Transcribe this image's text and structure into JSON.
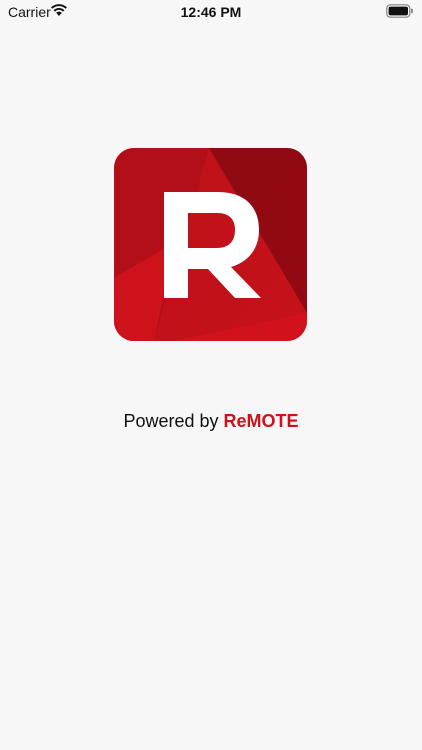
{
  "status_bar": {
    "carrier": "Carrier",
    "time": "12:46 PM",
    "icons": [
      "wifi-icon",
      "battery-icon"
    ]
  },
  "logo": {
    "letter": "R",
    "colors": {
      "dark": "#8e0b12",
      "mid": "#b8101a",
      "light": "#d8141c"
    }
  },
  "footer": {
    "prefix": "Powered by",
    "brand": "ReMOTE",
    "brand_color": "#d0101a"
  }
}
